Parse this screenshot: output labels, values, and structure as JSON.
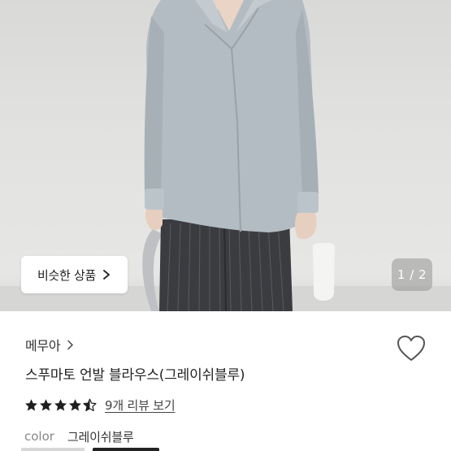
{
  "similar_button": {
    "label": "비슷한 상품"
  },
  "gallery": {
    "indicator": "1 / 2"
  },
  "product": {
    "brand": "메무아",
    "title": "스푸마토 언발 블라우스(그레이쉬블루)",
    "rating": 4.5,
    "review_link": "9개 리뷰 보기",
    "option_label": "color",
    "option_value": "그레이쉬블루"
  },
  "icons": {
    "similar_chevron": "chevron-right-icon",
    "brand_chevron": "chevron-right-icon",
    "wishlist": "heart-outline-icon",
    "star": "star-icon"
  },
  "colors": {
    "star": "#1f1f1f",
    "blouse": "#b4bcc3",
    "trousers": "#3b3c40"
  }
}
